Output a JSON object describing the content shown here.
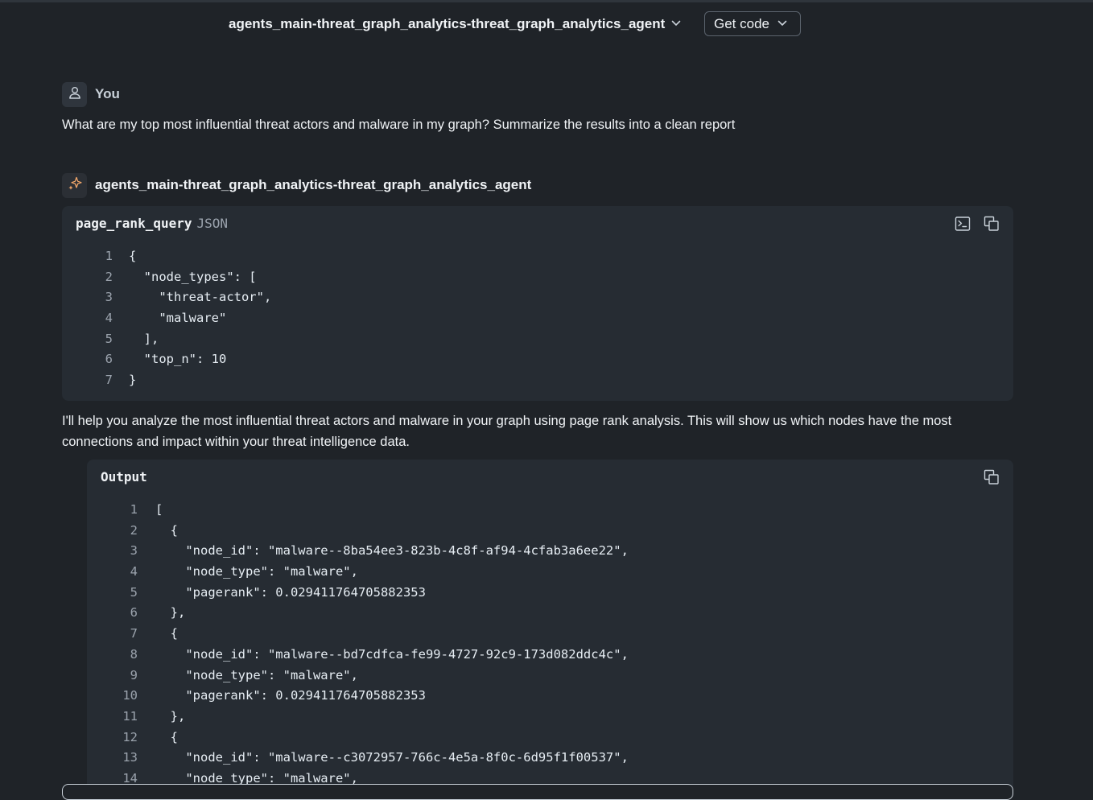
{
  "header": {
    "agent_name": "agents_main-threat_graph_analytics-threat_graph_analytics_agent",
    "get_code_label": "Get code"
  },
  "user_message": {
    "author": "You",
    "text": "What are my top most influential threat actors and malware in my graph? Summarize the results into a clean report"
  },
  "agent_message": {
    "author": "agents_main-threat_graph_analytics-threat_graph_analytics_agent",
    "tool_call": {
      "name": "page_rank_query",
      "lang": "JSON",
      "lines": [
        {
          "n": "1",
          "code": "{"
        },
        {
          "n": "2",
          "code": "  \"node_types\": ["
        },
        {
          "n": "3",
          "code": "    \"threat-actor\","
        },
        {
          "n": "4",
          "code": "    \"malware\""
        },
        {
          "n": "5",
          "code": "  ],"
        },
        {
          "n": "6",
          "code": "  \"top_n\": 10"
        },
        {
          "n": "7",
          "code": "}"
        }
      ]
    },
    "text": "I'll help you analyze the most influential threat actors and malware in your graph using page rank analysis. This will show us which nodes have the most connections and impact within your threat intelligence data.",
    "output": {
      "title": "Output",
      "lines": [
        {
          "n": "1",
          "code": "["
        },
        {
          "n": "2",
          "code": "  {"
        },
        {
          "n": "3",
          "code": "    \"node_id\": \"malware--8ba54ee3-823b-4c8f-af94-4cfab3a6ee22\","
        },
        {
          "n": "4",
          "code": "    \"node_type\": \"malware\","
        },
        {
          "n": "5",
          "code": "    \"pagerank\": 0.029411764705882353"
        },
        {
          "n": "6",
          "code": "  },"
        },
        {
          "n": "7",
          "code": "  {"
        },
        {
          "n": "8",
          "code": "    \"node_id\": \"malware--bd7cdfca-fe99-4727-92c9-173d082ddc4c\","
        },
        {
          "n": "9",
          "code": "    \"node_type\": \"malware\","
        },
        {
          "n": "10",
          "code": "    \"pagerank\": 0.029411764705882353"
        },
        {
          "n": "11",
          "code": "  },"
        },
        {
          "n": "12",
          "code": "  {"
        },
        {
          "n": "13",
          "code": "    \"node_id\": \"malware--c3072957-766c-4e5a-8f0c-6d95f1f00537\","
        },
        {
          "n": "14",
          "code": "    \"node_type\": \"malware\","
        }
      ]
    }
  },
  "icons": {
    "agent_select_chevron": "chevron-down-icon",
    "get_code_chevron": "chevron-down-icon",
    "user_avatar": "person-icon",
    "agent_avatar": "sparkle-icon",
    "terminal": "terminal-icon",
    "copy": "copy-icon"
  },
  "colors": {
    "background": "#1f2328",
    "code_background": "#262c33",
    "sparkle": "#f0a66a",
    "text": "#f0f3f6",
    "muted": "#9ba3ad"
  }
}
